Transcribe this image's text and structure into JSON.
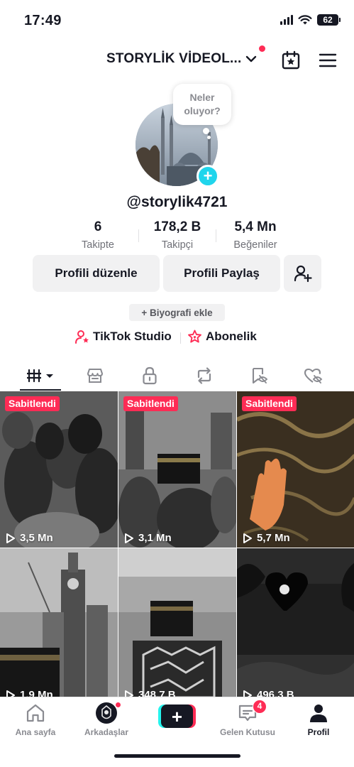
{
  "status_bar": {
    "time": "17:49",
    "battery": "62"
  },
  "header": {
    "account_name": "STORYLİK VİDEOL..."
  },
  "profile": {
    "note_line1": "Neler",
    "note_line2": "oluyor?",
    "username": "@storylik4721",
    "stats": [
      {
        "value": "6",
        "label": "Takipte"
      },
      {
        "value": "178,2 B",
        "label": "Takipçi"
      },
      {
        "value": "5,4 Mn",
        "label": "Beğeniler"
      }
    ],
    "edit_button": "Profili düzenle",
    "share_button": "Profili Paylaş",
    "bio_button": "+ Biyografi ekle",
    "links": [
      {
        "label": "TikTok Studio",
        "icon": "person-star-icon"
      },
      {
        "label": "Abonelik",
        "icon": "star-heart-icon"
      }
    ]
  },
  "tabs": [
    {
      "name": "videos",
      "icon": "grid-bars-icon",
      "active": true
    },
    {
      "name": "shop",
      "icon": "shop-icon"
    },
    {
      "name": "private",
      "icon": "lock-icon"
    },
    {
      "name": "reposts",
      "icon": "repost-icon"
    },
    {
      "name": "saved",
      "icon": "bookmark-hidden-icon"
    },
    {
      "name": "liked",
      "icon": "heart-hidden-icon"
    }
  ],
  "videos": [
    {
      "pinned_label": "Sabitlendi",
      "views": "3,5 Mn"
    },
    {
      "pinned_label": "Sabitlendi",
      "views": "3,1 Mn"
    },
    {
      "pinned_label": "Sabitlendi",
      "views": "5,7 Mn"
    },
    {
      "views": "1,9 Mn"
    },
    {
      "views": "348,7 B"
    },
    {
      "views": "496,3 B"
    }
  ],
  "bottom_nav": {
    "home": "Ana sayfa",
    "friends": "Arkadaşlar",
    "inbox": "Gelen Kutusu",
    "inbox_badge": "4",
    "profile": "Profil",
    "plus": "+"
  },
  "colors": {
    "accent": "#fe2c55",
    "cyan": "#25f4ee",
    "text": "#161823",
    "muted": "#8a8b91"
  }
}
